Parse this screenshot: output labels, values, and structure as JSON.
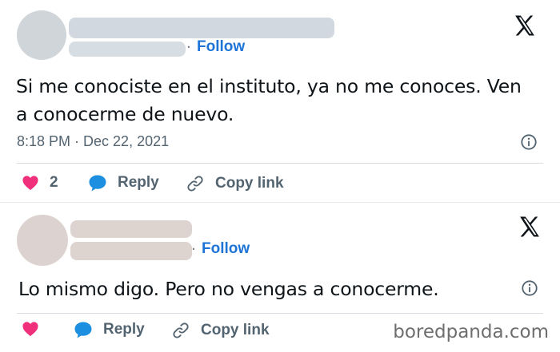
{
  "tweets": [
    {
      "follow_label": "Follow",
      "separator": "·",
      "text": "Si me conociste en el instituto, ya no me conoces. Ven a conocerme de nuevo.",
      "timestamp": "8:18 PM · Dec 22, 2021",
      "like_count": "2",
      "reply_label": "Reply",
      "copy_link_label": "Copy link"
    },
    {
      "follow_label": "Follow",
      "separator": "·",
      "text": "Lo mismo digo. Pero no vengas a conocerme.",
      "reply_label": "Reply",
      "copy_link_label": "Copy link"
    }
  ],
  "icons": {
    "platform": "x-logo-icon",
    "info": "info-icon",
    "like": "heart-icon",
    "reply": "speech-bubble-icon",
    "copy_link": "link-icon"
  },
  "colors": {
    "follow": "#1d74d6",
    "heart": "#f0307a",
    "reply_bubble": "#1d8fe0",
    "muted_text": "#536471"
  },
  "watermark": "boredpanda.com"
}
